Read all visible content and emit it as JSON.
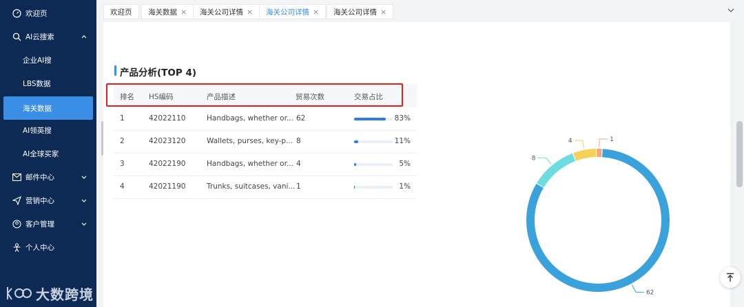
{
  "sidebar": {
    "items": [
      {
        "label": "欢迎页",
        "icon": "dashboard-icon"
      },
      {
        "label": "AI云搜索",
        "icon": "search-icon"
      },
      {
        "label": "企业AI搜"
      },
      {
        "label": "LBS数据"
      },
      {
        "label": "海关数据"
      },
      {
        "label": "AI领英搜"
      },
      {
        "label": "AI全球买家"
      },
      {
        "label": "邮件中心",
        "icon": "mail-icon"
      },
      {
        "label": "营销中心",
        "icon": "send-icon"
      },
      {
        "label": "客户管理",
        "icon": "customer-icon"
      },
      {
        "label": "个人中心",
        "icon": "user-icon"
      }
    ],
    "logo_text": "大数跨境"
  },
  "tabs": [
    {
      "label": "欢迎页",
      "closable": false
    },
    {
      "label": "海关数据",
      "closable": true
    },
    {
      "label": "海关公司详情",
      "closable": true
    },
    {
      "label": "海关公司详情",
      "closable": true,
      "active": true
    },
    {
      "label": "海关公司详情",
      "closable": true
    }
  ],
  "tab_close_glyph": "×",
  "section": {
    "title": "产品分析(TOP 4)"
  },
  "table": {
    "headers": [
      "排名",
      "HS编码",
      "产品描述",
      "贸易次数",
      "交易占比"
    ],
    "rows": [
      {
        "rank": "1",
        "hs": "42022110",
        "desc": "Handbags, whether or...",
        "count": "62",
        "pct_label": "83%",
        "pct": 0.83
      },
      {
        "rank": "2",
        "hs": "42023120",
        "desc": "Wallets, purses, key-p...",
        "count": "8",
        "pct_label": "11%",
        "pct": 0.11
      },
      {
        "rank": "3",
        "hs": "42022190",
        "desc": "Handbags, whether or...",
        "count": "4",
        "pct_label": "5%",
        "pct": 0.05
      },
      {
        "rank": "4",
        "hs": "42021190",
        "desc": "Trunks, suitcases, vani...",
        "count": "1",
        "pct_label": "1%",
        "pct": 0.01
      }
    ]
  },
  "chart_data": {
    "type": "pie",
    "style": "donut",
    "slices": [
      {
        "label": "62",
        "value": 62,
        "color": "#3ba1db"
      },
      {
        "label": "8",
        "value": 8,
        "color": "#6ddce0"
      },
      {
        "label": "4",
        "value": 4,
        "color": "#f5d15a"
      },
      {
        "label": "1",
        "value": 1,
        "color": "#f3a77d"
      }
    ]
  },
  "colors": {
    "sidebar_bg": "#0d2a54",
    "accent": "#3a8ee6",
    "highlight_box": "#e02020"
  }
}
